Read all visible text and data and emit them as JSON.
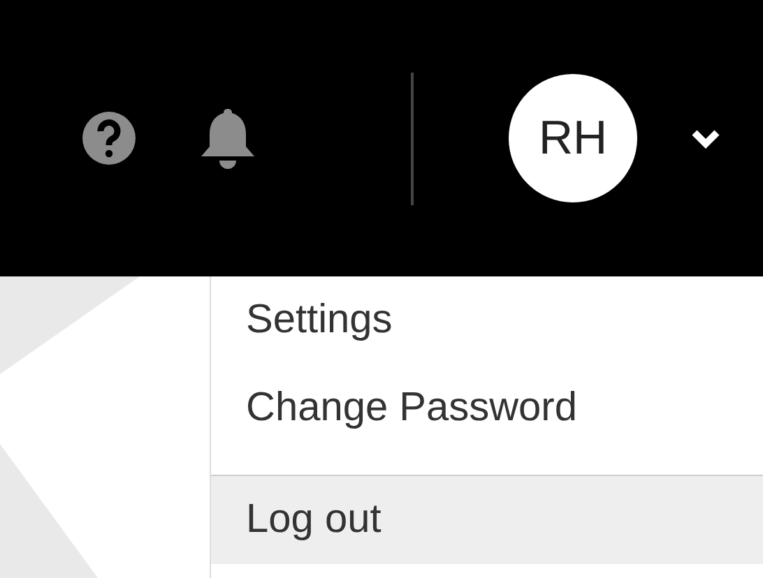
{
  "header": {
    "avatar": {
      "initials": "RH"
    }
  },
  "menu": {
    "items": [
      {
        "label": "Settings",
        "selected": false
      },
      {
        "label": "Change Password",
        "selected": false
      },
      {
        "label": "Log out",
        "selected": true
      }
    ]
  }
}
